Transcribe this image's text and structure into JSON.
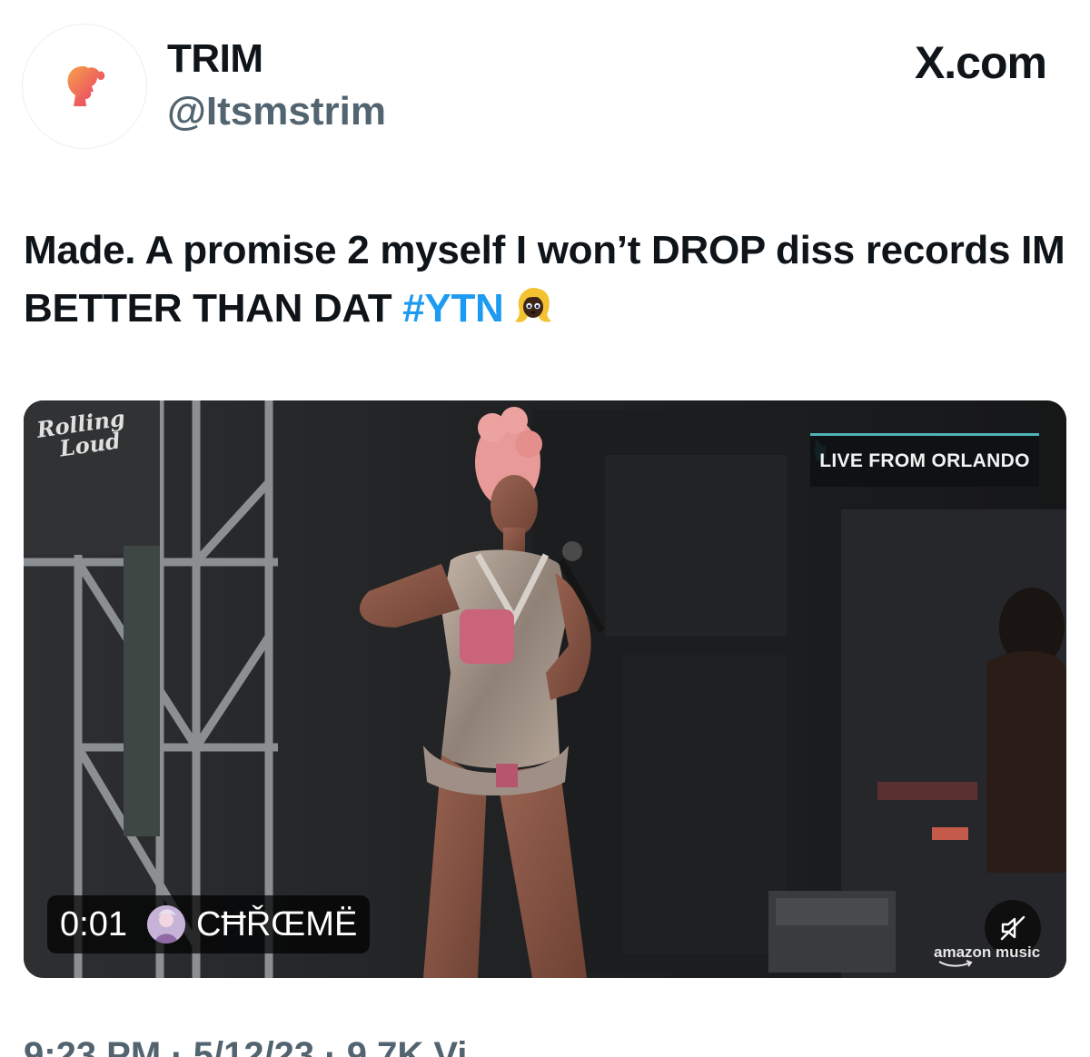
{
  "header": {
    "display_name": "TRIM",
    "handle": "@Itsmstrim",
    "site_label": "X.com",
    "avatar_icon": "barbie-head-icon"
  },
  "tweet": {
    "text_main": "Made. A promise 2 myself I won’t DROP diss records IM BETTER THAN DAT",
    "hashtag": "#YTN",
    "emoji_icon": "blonde-woman-emoji-icon"
  },
  "media": {
    "watermark_line1": "Rolling",
    "watermark_line2": "Loud",
    "banner_text": "LIVE FROM ORLANDO",
    "duration": "0:01",
    "source_name": "CĦŘŒMЁ",
    "brand_text": "amazon music",
    "mute_icon": "volume-muted-icon"
  },
  "footer": {
    "meta": "9:23 PM · 5/12/23 · 9.7K Vi"
  },
  "colors": {
    "hashtag": "#1d9bf0",
    "secondary_text": "#536471",
    "banner_accent": "#4fb3b9"
  }
}
